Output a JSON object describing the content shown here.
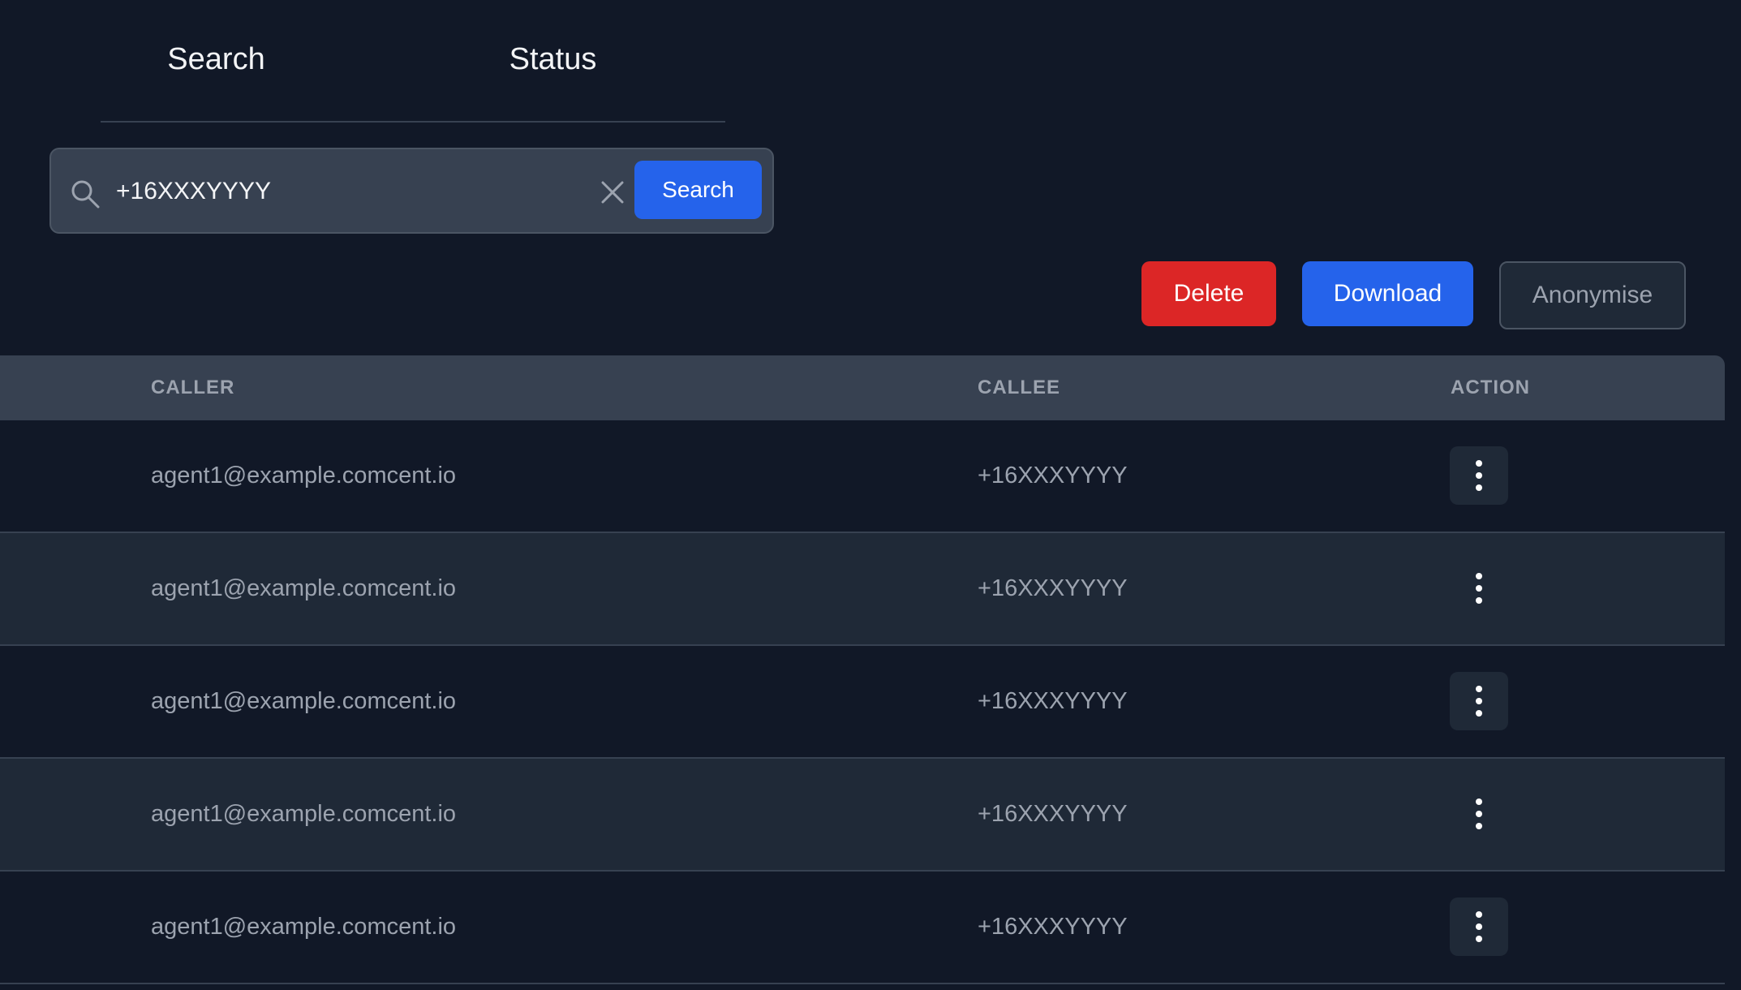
{
  "tabs": [
    {
      "label": "Search"
    },
    {
      "label": "Status"
    }
  ],
  "search": {
    "value": "+16XXXYYYY",
    "placeholder": "",
    "button_label": "Search"
  },
  "actions": {
    "delete_label": "Delete",
    "download_label": "Download",
    "anonymise_label": "Anonymise"
  },
  "table": {
    "columns": [
      "CALLER",
      "CALLEE",
      "ACTION"
    ],
    "rows": [
      {
        "caller": "agent1@example.comcent.io",
        "callee": "+16XXXYYYY"
      },
      {
        "caller": "agent1@example.comcent.io",
        "callee": "+16XXXYYYY"
      },
      {
        "caller": "agent1@example.comcent.io",
        "callee": "+16XXXYYYY"
      },
      {
        "caller": "agent1@example.comcent.io",
        "callee": "+16XXXYYYY"
      },
      {
        "caller": "agent1@example.comcent.io",
        "callee": "+16XXXYYYY"
      }
    ]
  },
  "colors": {
    "background": "#111827",
    "accent": "#2563eb",
    "danger": "#dc2626"
  },
  "icons": {
    "search": "search-icon",
    "clear": "close-icon",
    "row_menu": "more-vertical-icon"
  }
}
